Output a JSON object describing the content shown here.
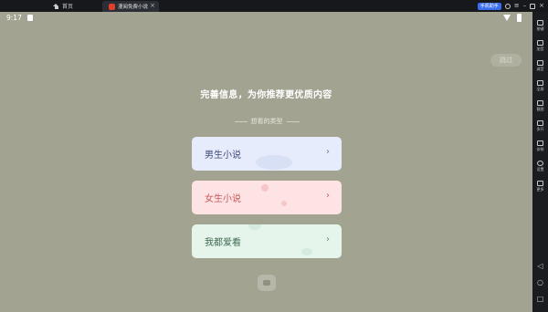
{
  "emulator": {
    "tabs": [
      {
        "label": "首页"
      },
      {
        "label": "漫阅免费小说"
      }
    ],
    "helper_button": "手机助手",
    "sidebar": [
      {
        "label": "按键",
        "icon": "keyboard-icon"
      },
      {
        "label": "加音",
        "icon": "volume-up-icon"
      },
      {
        "label": "减音",
        "icon": "volume-down-icon"
      },
      {
        "label": "全屏",
        "icon": "fullscreen-icon"
      },
      {
        "label": "截图",
        "icon": "screenshot-icon"
      },
      {
        "label": "多开",
        "icon": "multi-instance-icon"
      },
      {
        "label": "安装",
        "icon": "install-icon"
      },
      {
        "label": "设置",
        "icon": "settings-icon"
      },
      {
        "label": "更多",
        "icon": "more-icon"
      }
    ],
    "nav": [
      {
        "icon": "back-icon"
      },
      {
        "icon": "home-icon"
      },
      {
        "icon": "recents-icon"
      }
    ]
  },
  "status_bar": {
    "time": "9:17"
  },
  "onboarding": {
    "skip_label": "跳过",
    "headline": "完善信息，为你推荐更优质内容",
    "subtitle": "想看的类型",
    "choices": [
      {
        "label": "男生小说",
        "bg": "#e6ecfb"
      },
      {
        "label": "女生小说",
        "bg": "#fde3e3"
      },
      {
        "label": "我都爱看",
        "bg": "#e6f5ec"
      }
    ]
  },
  "colors": {
    "screen_bg": "#a2a390",
    "accent": "#3a6df0"
  }
}
